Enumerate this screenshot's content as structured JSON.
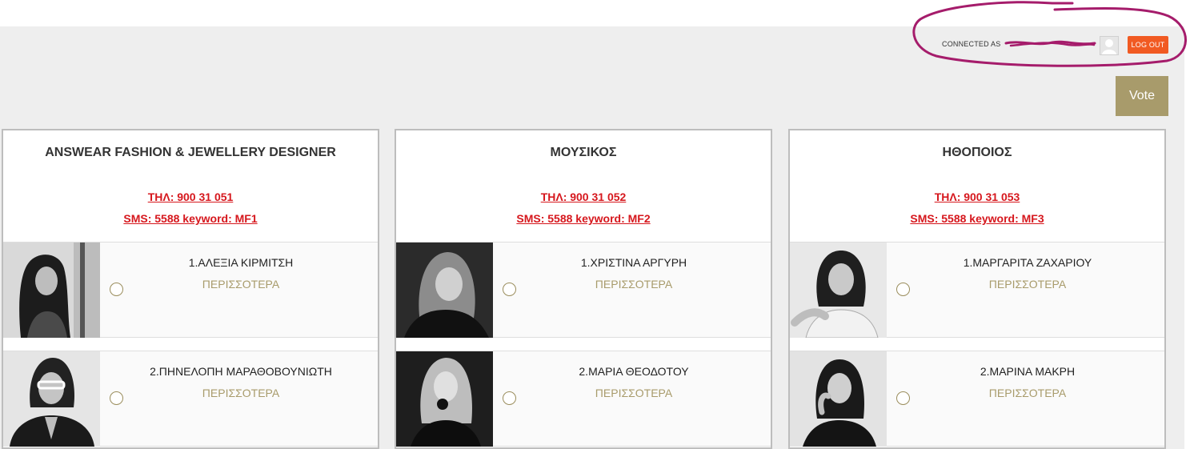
{
  "header": {
    "connected_label": "CONNECTED AS",
    "logout_label": "LOG OUT",
    "vote_label": "Vote",
    "accent_color": "#f15a22",
    "annotation_color": "#a51c6b"
  },
  "categories": [
    {
      "title": "ANSWEAR FASHION & JEWELLERY DESIGNER",
      "phone": "ΤΗΛ: 900 31 051",
      "sms": "SMS: 5588 keyword: MF1",
      "candidates": [
        {
          "name": "1.ΑΛΕΞΙΑ ΚΙΡΜΙΤΣΗ",
          "more": "ΠΕΡΙΣΣΟΤΕΡΑ",
          "icon": "portrait-photo"
        },
        {
          "name": "2.ΠΗΝΕΛΟΠΗ ΜΑΡΑΘΟΒΟΥΝΙΩΤΗ",
          "more": "ΠΕΡΙΣΣΟΤΕΡΑ",
          "icon": "portrait-photo"
        }
      ]
    },
    {
      "title": "ΜΟΥΣΙΚΟΣ",
      "phone": "ΤΗΛ: 900 31 052",
      "sms": "SMS: 5588 keyword: MF2",
      "candidates": [
        {
          "name": "1.ΧΡΙΣΤΙΝΑ ΑΡΓΥΡΗ",
          "more": "ΠΕΡΙΣΣΟΤΕΡΑ",
          "icon": "portrait-photo"
        },
        {
          "name": "2.ΜΑΡΙΑ ΘΕΟΔΟΤΟΥ",
          "more": "ΠΕΡΙΣΣΟΤΕΡΑ",
          "icon": "portrait-photo"
        }
      ]
    },
    {
      "title": "ΗΘΟΠΟΙΟΣ",
      "phone": "ΤΗΛ: 900 31 053",
      "sms": "SMS: 5588 keyword: MF3",
      "candidates": [
        {
          "name": "1.ΜΑΡΓΑΡΙΤΑ ΖΑΧΑΡΙΟΥ",
          "more": "ΠΕΡΙΣΣΟΤΕΡΑ",
          "icon": "portrait-photo"
        },
        {
          "name": "2.ΜΑΡΙΝΑ ΜΑΚΡΗ",
          "more": "ΠΕΡΙΣΣΟΤΕΡΑ",
          "icon": "portrait-photo"
        }
      ]
    }
  ]
}
